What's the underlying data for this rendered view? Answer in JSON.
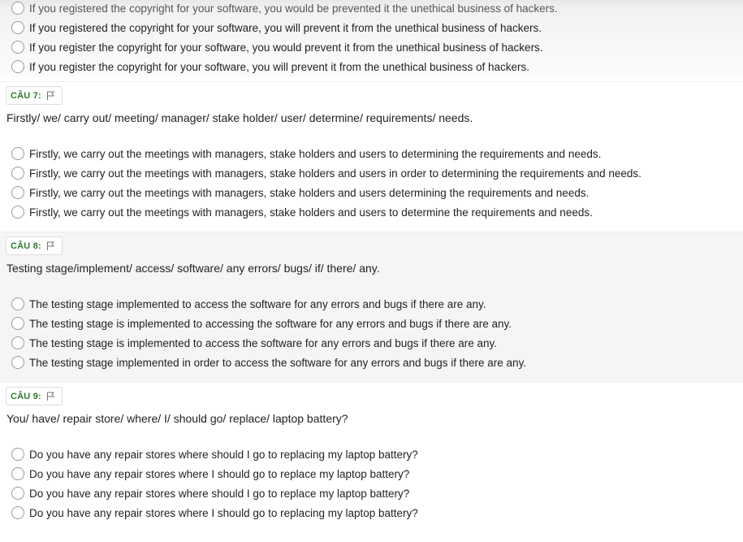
{
  "previous_question": {
    "options": [
      "If you registered the copyright for your software, you would be prevented it the unethical business of hackers.",
      "If you registered the copyright for your software, you will prevent it from the unethical business of hackers.",
      "If you register the copyright for your software, you would prevent it from the unethical business of hackers.",
      "If you register the copyright for your software, you will prevent it from the unethical business of hackers."
    ]
  },
  "questions": [
    {
      "label": "CÂU 7:",
      "prompt": "Firstly/ we/ carry out/ meeting/ manager/ stake holder/ user/ determine/ requirements/ needs.",
      "options": [
        "Firstly, we carry out the meetings with managers, stake holders and users to determining the requirements and needs.",
        "Firstly, we carry out the meetings with managers, stake holders and users in order to determining the requirements and needs.",
        "Firstly, we carry out the meetings with managers, stake holders and users determining the requirements and needs.",
        "Firstly, we carry out the meetings with managers, stake holders and users to determine the requirements and needs."
      ]
    },
    {
      "label": "CÂU 8:",
      "prompt": "Testing stage/implement/ access/ software/ any errors/ bugs/ if/ there/ any.",
      "options": [
        "The testing stage implemented to access the software for any errors and bugs if there are any.",
        "The testing stage is implemented to accessing the software for any errors and bugs if there are any.",
        "The testing stage is implemented to access the software for any errors and bugs if there are any.",
        "The testing stage implemented in order to access the software for any errors and bugs if there are any."
      ]
    },
    {
      "label": "CÂU 9:",
      "prompt": "You/ have/ repair store/ where/ I/ should go/ replace/ laptop battery?",
      "options": [
        "Do you have any repair stores where should I go to replacing my laptop battery?",
        "Do you have any repair stores where I should go to replace my laptop battery?",
        "Do you have any repair stores where should I go to replace my laptop battery?",
        "Do you have any repair stores where I should go to replacing my laptop battery?"
      ]
    }
  ],
  "icons": {
    "flag": "flag-icon",
    "radio": "radio-empty"
  },
  "colors": {
    "question_label": "#2a7a2a",
    "alt_background": "#f5f5f5"
  }
}
